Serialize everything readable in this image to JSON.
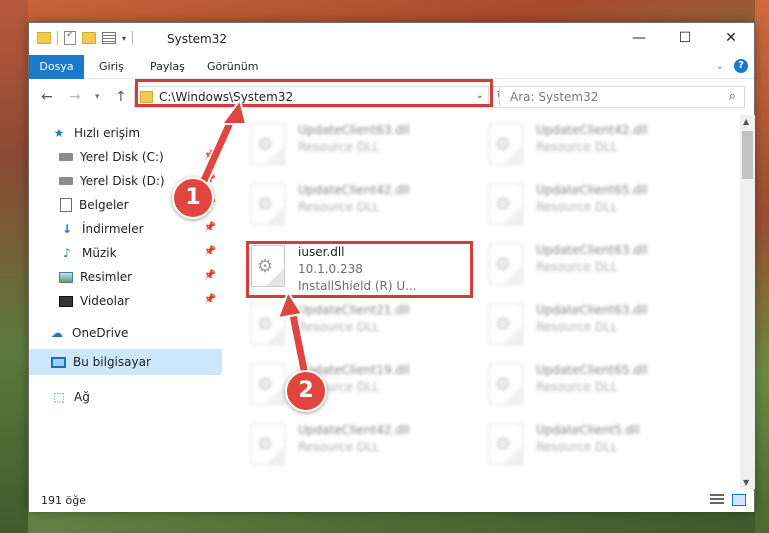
{
  "window": {
    "title": "System32",
    "controls": {
      "minimize": "—",
      "maximize": "☐",
      "close": "✕"
    }
  },
  "ribbon": {
    "tabs": [
      "Dosya",
      "Giriş",
      "Paylaş",
      "Görünüm"
    ]
  },
  "navigation": {
    "address": "C:\\Windows\\System32",
    "search_placeholder": "Ara: System32"
  },
  "sidebar": {
    "items": [
      {
        "label": "Hızlı erişim",
        "icon": "star-icon"
      },
      {
        "label": "Yerel Disk (C:)",
        "icon": "disk-icon",
        "pinned": true
      },
      {
        "label": "Yerel Disk (D:)",
        "icon": "disk-icon",
        "pinned": true
      },
      {
        "label": "Belgeler",
        "icon": "documents-icon",
        "pinned": true
      },
      {
        "label": "İndirmeler",
        "icon": "downloads-icon",
        "pinned": true
      },
      {
        "label": "Müzik",
        "icon": "music-icon",
        "pinned": true
      },
      {
        "label": "Resimler",
        "icon": "pictures-icon",
        "pinned": true
      },
      {
        "label": "Videolar",
        "icon": "videos-icon",
        "pinned": true
      },
      {
        "label": "OneDrive",
        "icon": "cloud-icon"
      },
      {
        "label": "Bu bilgisayar",
        "icon": "computer-icon",
        "selected": true
      },
      {
        "label": "Ağ",
        "icon": "network-icon"
      }
    ]
  },
  "files": {
    "highlighted": {
      "name": "iuser.dll",
      "version": "10.1.0.238",
      "description": "InstallShield (R) U..."
    },
    "left_column": [
      {
        "name": "UpdateClient63.dll",
        "type": "Resource DLL"
      },
      {
        "name": "UpdateClient42.dll",
        "type": "Resource DLL"
      },
      {
        "name": "UpdateClient21.dll",
        "type": "Resource DLL"
      },
      {
        "name": "UpdateClient19.dll",
        "type": "Resource DLL"
      },
      {
        "name": "UpdateClient42.dll",
        "type": "Resource DLL"
      }
    ],
    "right_column": [
      {
        "name": "UpdateClient42.dll",
        "type": "Resource DLL"
      },
      {
        "name": "UpdateClient65.dll",
        "type": "Resource DLL"
      },
      {
        "name": "UpdateClient63.dll",
        "type": "Resource DLL"
      },
      {
        "name": "UpdateClient63.dll",
        "type": "Resource DLL"
      },
      {
        "name": "UpdateClient65.dll",
        "type": "Resource DLL"
      },
      {
        "name": "UpdateClient5.dll",
        "type": "Resource DLL"
      }
    ]
  },
  "status": {
    "item_count": "191 öğe"
  },
  "callouts": {
    "first": "1",
    "second": "2"
  },
  "colors": {
    "accent": "#1979ca",
    "highlight_red": "#d63b3b",
    "callout_red": "#e0463f",
    "selection": "#cce8ff"
  }
}
